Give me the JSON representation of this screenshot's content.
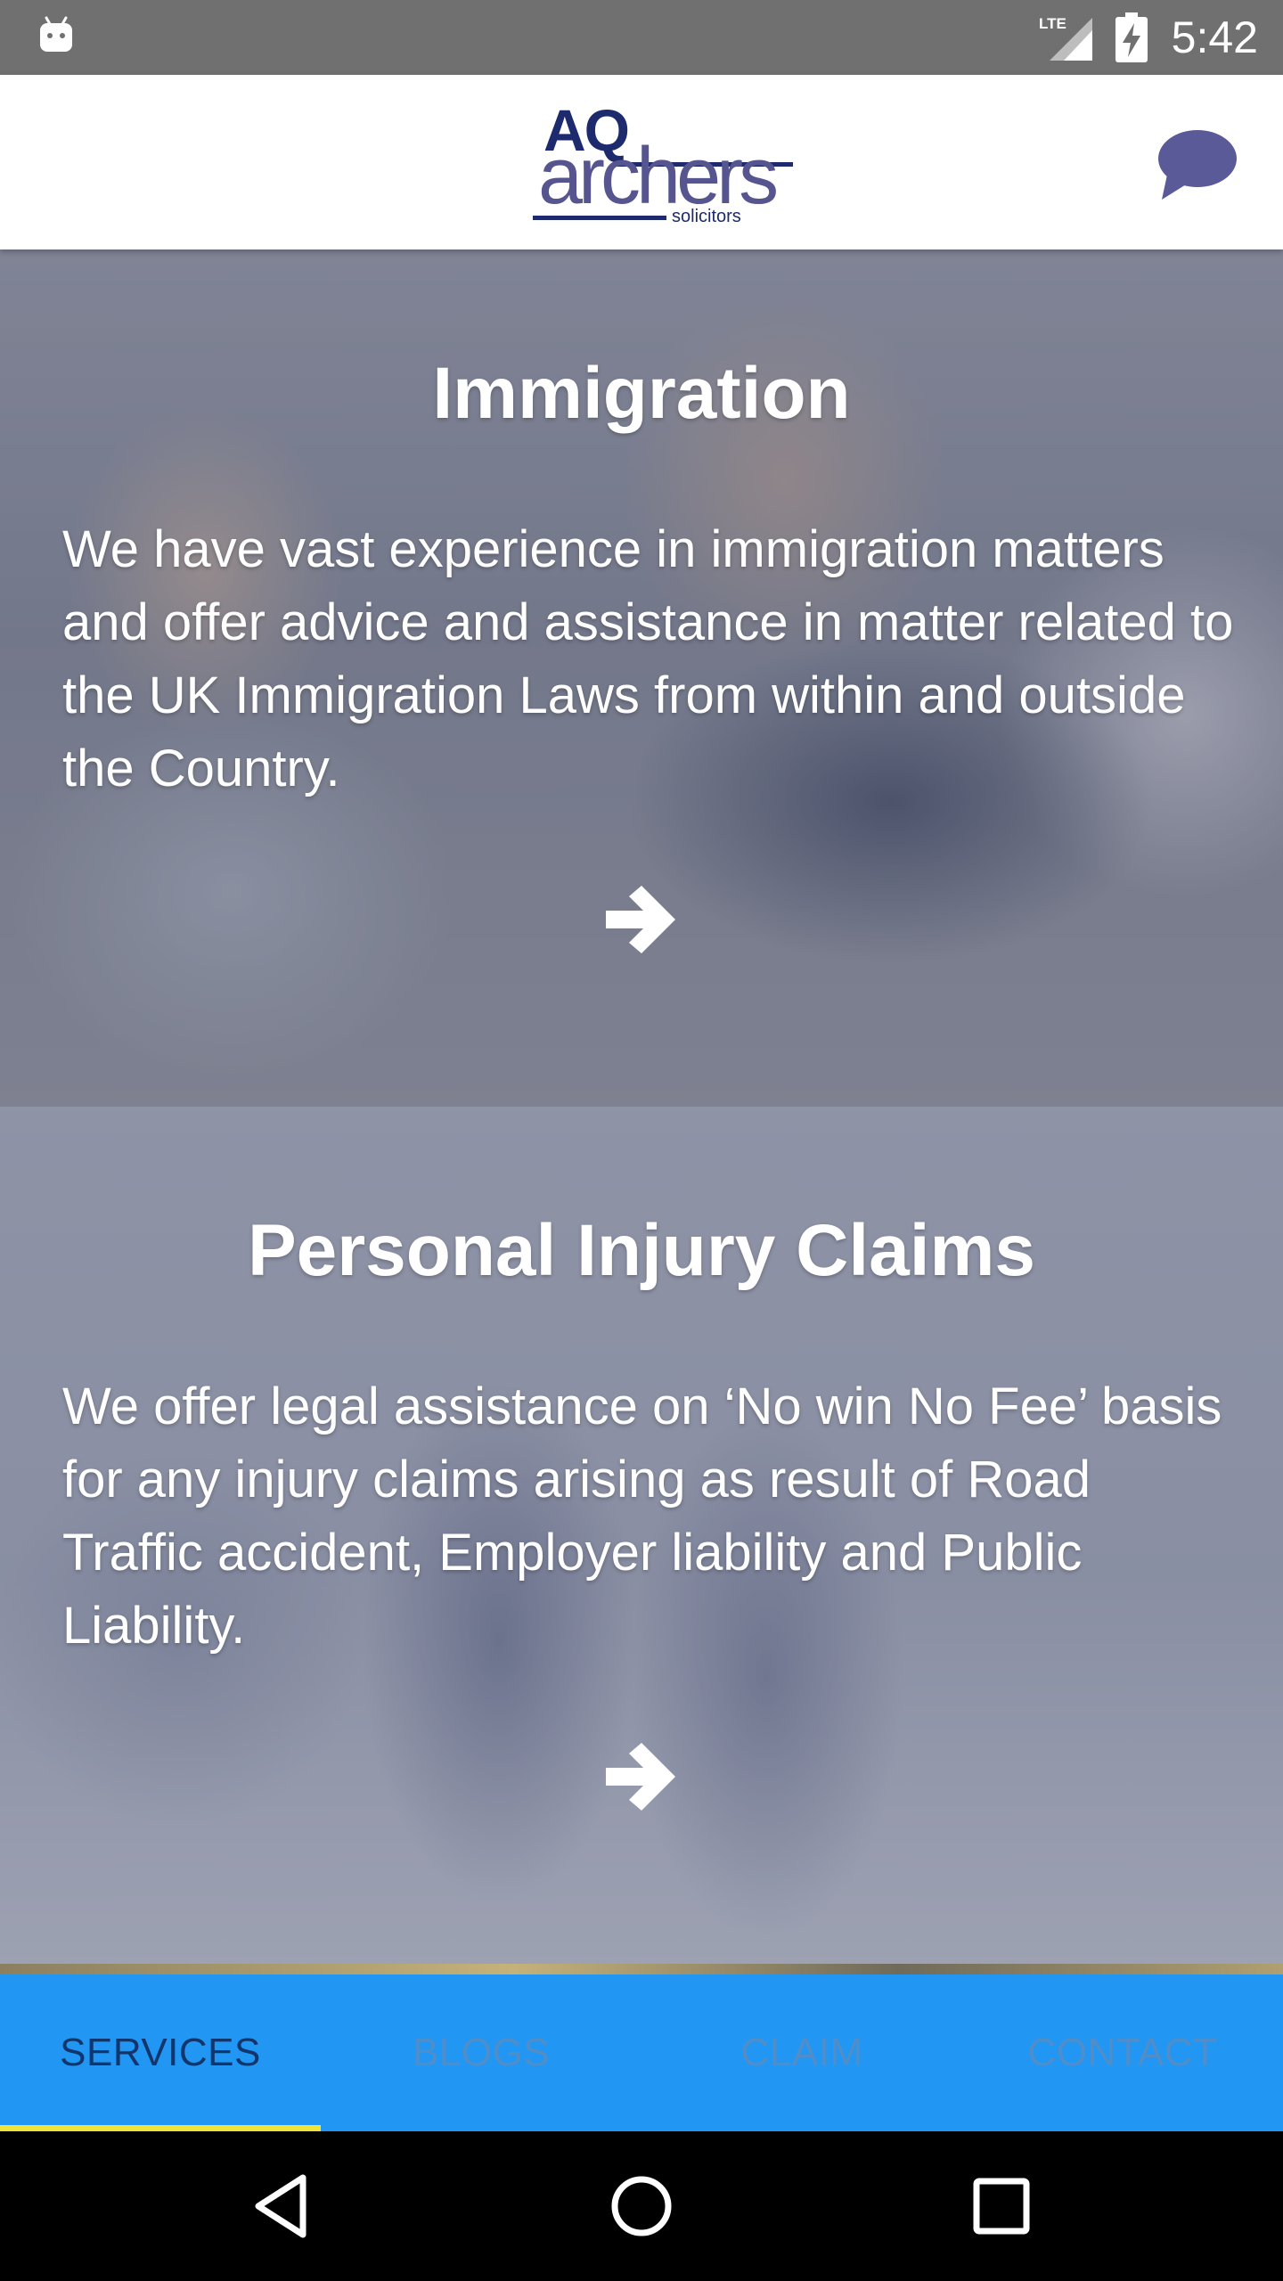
{
  "status_bar": {
    "network": "LTE",
    "time": "5:42",
    "icons": [
      "android-icon",
      "lte-signal-icon",
      "battery-charging-icon"
    ]
  },
  "header": {
    "logo": {
      "line1": "AQ",
      "line2": "archers",
      "line3": "solicitors"
    },
    "chat_icon": "chat-bubble-icon",
    "colors": {
      "logo_dark": "#1e2a6e",
      "logo_light": "#56558f",
      "chat": "#5a5a99"
    }
  },
  "services": [
    {
      "title": "Immigration",
      "description": "We have vast experience in immigration matters and offer advice and assistance in matter related to the UK Immigration Laws from within and outside the Country.",
      "action_icon": "arrow-right-icon"
    },
    {
      "title": "Personal Injury Claims",
      "description": "We offer legal assistance on ‘No win No Fee’ basis for any injury claims arising as result of Road Traffic accident, Employer liability and Public Liability.",
      "action_icon": "arrow-right-icon"
    }
  ],
  "tabs": [
    {
      "label": "SERVICES",
      "active": true
    },
    {
      "label": "BLOGS",
      "active": false
    },
    {
      "label": "CLAIM",
      "active": false
    },
    {
      "label": "CONTACT",
      "active": false
    }
  ],
  "tab_bar_colors": {
    "background": "#2196f3",
    "active_text": "#12366b",
    "inactive_text": "#4f8ec9",
    "indicator": "#f2e339"
  },
  "nav_bar": {
    "buttons": [
      "back-icon",
      "home-icon",
      "recents-icon"
    ]
  }
}
